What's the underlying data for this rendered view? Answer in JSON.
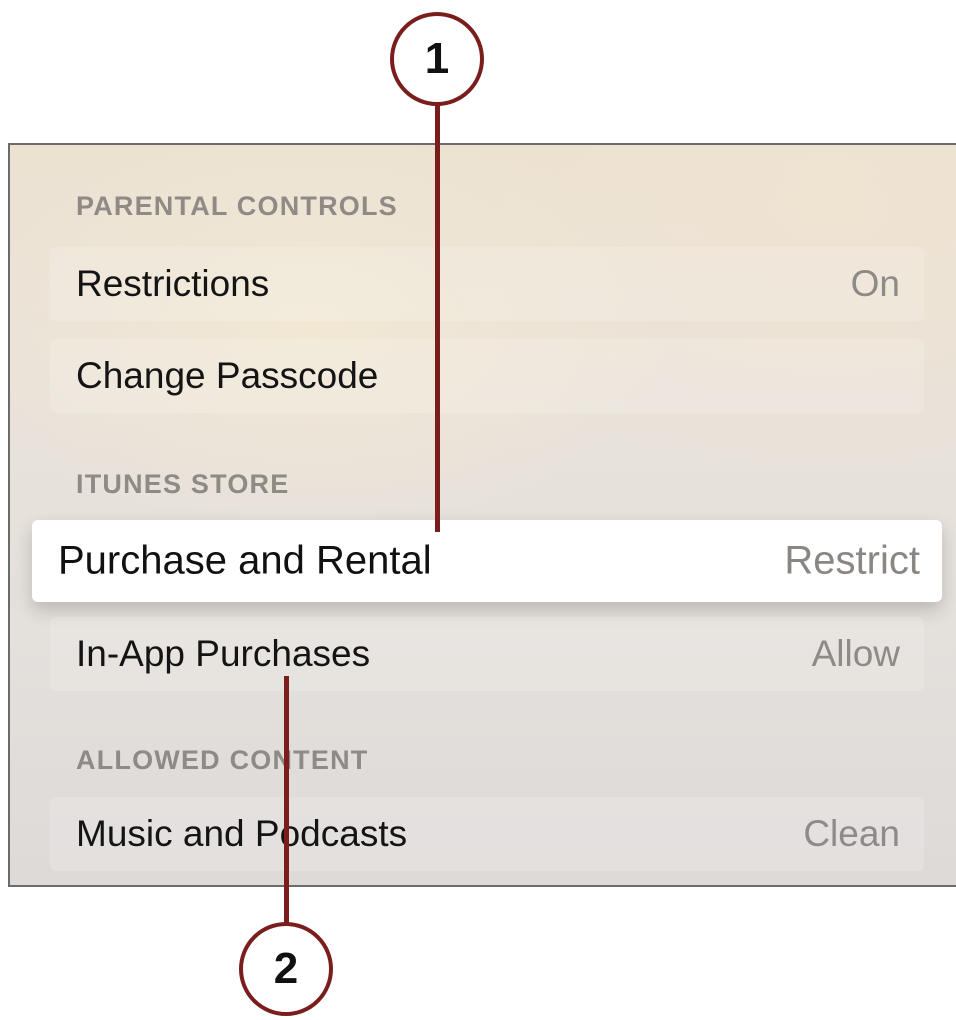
{
  "sections": [
    {
      "header": "PARENTAL CONTROLS"
    },
    {
      "header": "ITUNES STORE"
    },
    {
      "header": "ALLOWED CONTENT"
    }
  ],
  "rows": {
    "restrictions": {
      "label": "Restrictions",
      "value": "On"
    },
    "change_passcode": {
      "label": "Change Passcode",
      "value": ""
    },
    "purchase_rental": {
      "label": "Purchase and Rental",
      "value": "Restrict",
      "focused": true
    },
    "in_app": {
      "label": "In-App Purchases",
      "value": "Allow"
    },
    "music_podcasts": {
      "label": "Music and Podcasts",
      "value": "Clean"
    }
  },
  "callouts": [
    "1",
    "2"
  ],
  "colors": {
    "callout": "#7a1d1d",
    "focused_row": "#ffffff"
  }
}
